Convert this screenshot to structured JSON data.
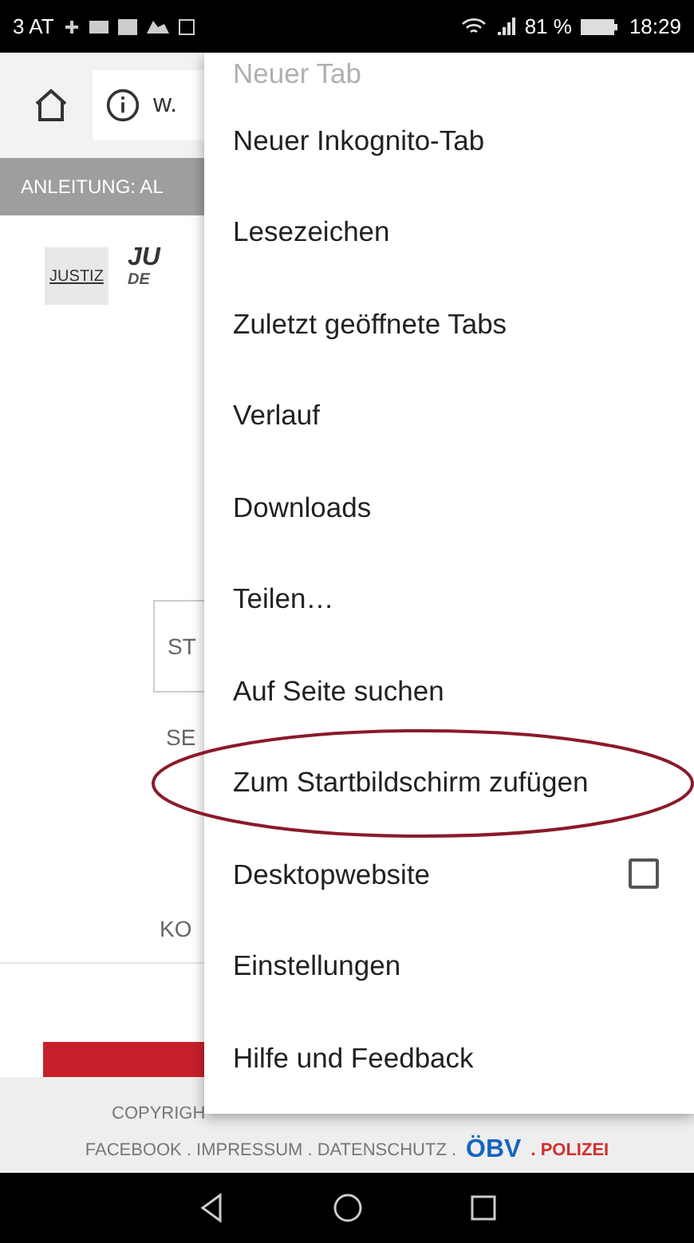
{
  "status_bar": {
    "carrier": "3 AT",
    "signal_text": "81 %",
    "time": "18:29"
  },
  "toolbar": {
    "url": "w."
  },
  "banner": {
    "text": "ANLEITUNG: AL"
  },
  "page": {
    "logo_text": "JUSTIZ",
    "heading_1": "JU",
    "heading_2": "DE",
    "field_text": "ST",
    "text_1": "SE",
    "text_2": "KO"
  },
  "footer": {
    "copyright": "COPYRIGH",
    "links": "FACEBOOK . IMPRESSUM . DATENSCHUTZ .",
    "logo_text": "ÖBV",
    "partner": ". POLIZEI"
  },
  "menu": {
    "items": [
      {
        "kind": "plain",
        "label": "Neuer Tab",
        "partial": true,
        "annotated": false
      },
      {
        "kind": "plain",
        "label": "Neuer Inkognito-Tab",
        "partial": false,
        "annotated": false
      },
      {
        "kind": "plain",
        "label": "Lesezeichen",
        "partial": false,
        "annotated": false
      },
      {
        "kind": "plain",
        "label": "Zuletzt geöffnete Tabs",
        "partial": false,
        "annotated": false
      },
      {
        "kind": "plain",
        "label": "Verlauf",
        "partial": false,
        "annotated": false
      },
      {
        "kind": "plain",
        "label": "Downloads",
        "partial": false,
        "annotated": false
      },
      {
        "kind": "plain",
        "label": "Teilen…",
        "partial": false,
        "annotated": false
      },
      {
        "kind": "plain",
        "label": "Auf Seite suchen",
        "partial": false,
        "annotated": false
      },
      {
        "kind": "plain",
        "label": "Zum Startbildschirm zufügen",
        "partial": false,
        "annotated": true
      },
      {
        "kind": "checkbox",
        "label": "Desktopwebsite",
        "checked": false,
        "partial": false,
        "annotated": false
      },
      {
        "kind": "plain",
        "label": "Einstellungen",
        "partial": false,
        "annotated": false
      },
      {
        "kind": "plain",
        "label": "Hilfe und Feedback",
        "partial": false,
        "annotated": false
      }
    ]
  }
}
